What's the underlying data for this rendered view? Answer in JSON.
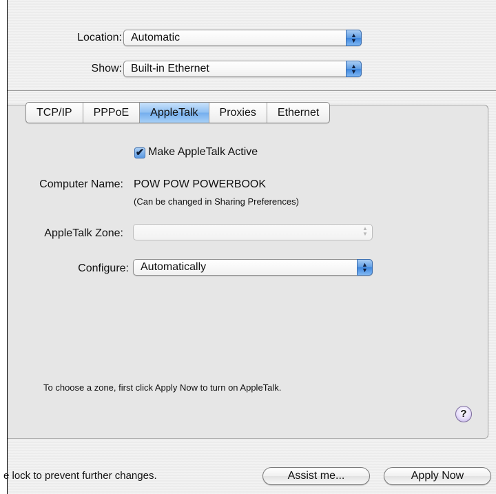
{
  "location": {
    "label": "Location:",
    "value": "Automatic"
  },
  "show": {
    "label": "Show:",
    "value": "Built-in Ethernet"
  },
  "tabs": [
    "TCP/IP",
    "PPPoE",
    "AppleTalk",
    "Proxies",
    "Ethernet"
  ],
  "active_tab": "AppleTalk",
  "appletalk": {
    "make_active_label": "Make AppleTalk Active",
    "make_active_checked": true,
    "computer_name_label": "Computer Name:",
    "computer_name_value": "POW POW POWERBOOK",
    "computer_name_note": "(Can be changed in Sharing Preferences)",
    "zone_label": "AppleTalk Zone:",
    "zone_value": "",
    "configure_label": "Configure:",
    "configure_value": "Automatically",
    "zone_hint": "To choose a zone, first click Apply Now to turn on AppleTalk.",
    "help_symbol": "?"
  },
  "footer": {
    "lock_text": "e lock to prevent further changes.",
    "assist_button": "Assist me...",
    "apply_button": "Apply Now"
  },
  "icons": {
    "checkmark": "✔",
    "popup_up": "▲",
    "popup_down": "▼"
  },
  "colors": {
    "accent_blue": "#5f9de4",
    "help_purple": "#b9a8e0"
  }
}
